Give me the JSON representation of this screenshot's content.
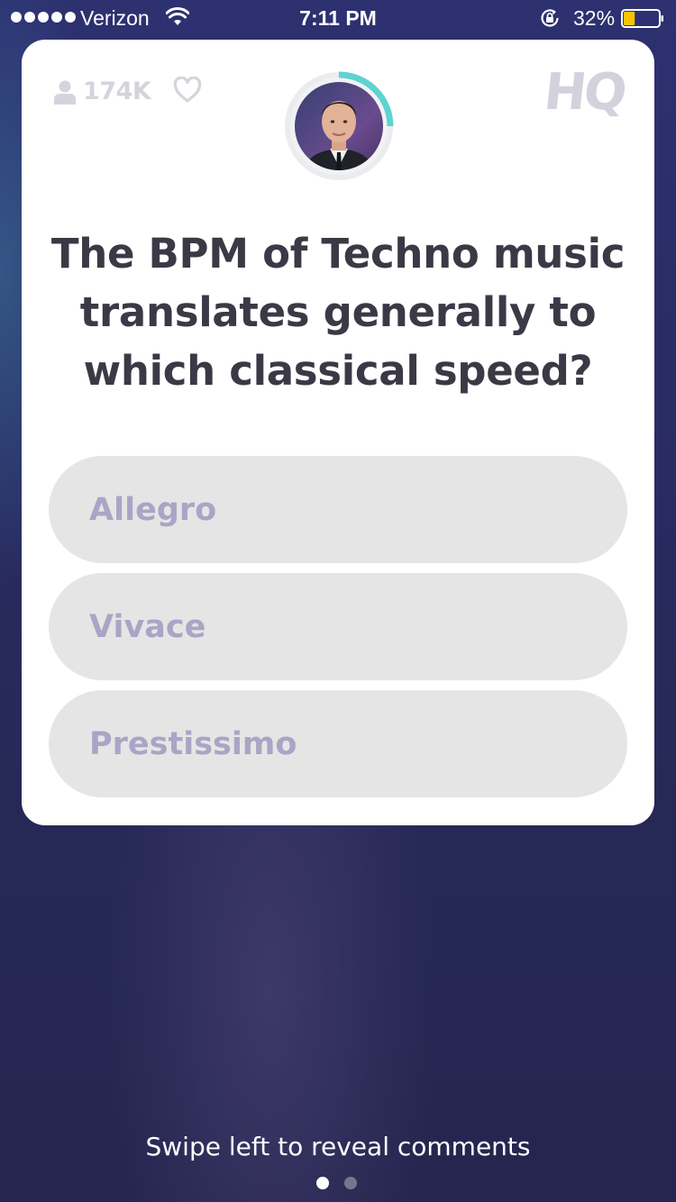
{
  "status_bar": {
    "carrier": "Verizon",
    "time": "7:11 PM",
    "battery_percent": "32%",
    "battery_level": 0.32,
    "signal_bars": 5,
    "icons": [
      "signal-dots-icon",
      "wifi-icon",
      "rotation-lock-icon",
      "battery-icon"
    ]
  },
  "header": {
    "viewer_count": "174K",
    "icons": [
      "person-icon",
      "heart-icon"
    ],
    "logo_text": "HQ",
    "timer_progress": 0.25
  },
  "question": {
    "text": "The BPM of Techno music translates generally to which classical speed?"
  },
  "answers": [
    {
      "label": "Allegro"
    },
    {
      "label": "Vivace"
    },
    {
      "label": "Prestissimo"
    }
  ],
  "footer": {
    "swipe_hint": "Swipe left to reveal comments",
    "pages": 2,
    "active_page": 1
  },
  "colors": {
    "background": "#2a2c66",
    "card": "#ffffff",
    "question_text": "#3a3a46",
    "answer_bg": "#e5e5e5",
    "answer_text": "#a9a5c6",
    "timer_ring": "#5fd2d2",
    "battery_fill": "#f5c400"
  }
}
